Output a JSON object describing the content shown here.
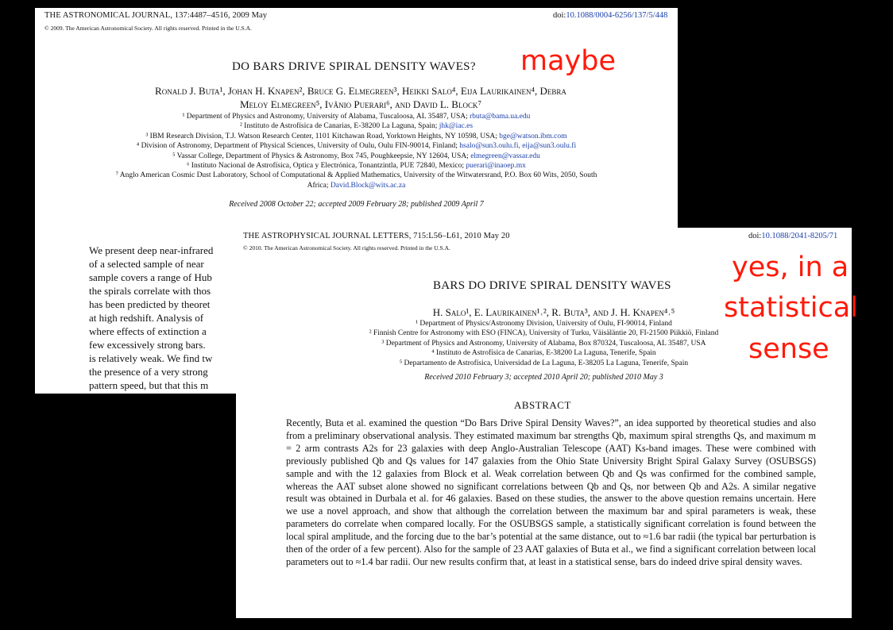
{
  "paper1": {
    "journal": "THE ASTRONOMICAL JOURNAL, 137:4487–4516, 2009 May",
    "doi_prefix": "doi:",
    "doi_link": "10.1088/0004-6256/137/5/448",
    "copyright": "© 2009. The American Astronomical Society. All rights reserved. Printed in the U.S.A.",
    "title": "DO BARS DRIVE SPIRAL DENSITY WAVES?",
    "author_lines": [
      "Ronald J. Buta¹, Johan H. Knapen², Bruce G. Elmegreen³, Heikki Salo⁴, Eija Laurikainen⁴, Debra",
      "Meloy Elmegreen⁵, Ivânio Puerari⁶, and David L. Block⁷"
    ],
    "affiliations": [
      {
        "text": "¹ Department of Physics and Astronomy, University of Alabama, Tuscaloosa, AL 35487, USA; ",
        "email": "rbuta@bama.ua.edu"
      },
      {
        "text": "² Instituto de Astrofísica de Canarias, E-38200 La Laguna, Spain; ",
        "email": "jhk@iac.es"
      },
      {
        "text": "³ IBM Research Division, T.J. Watson Research Center, 1101 Kitchawan Road, Yorktown Heights, NY 10598, USA; ",
        "email": "bge@watson.ibm.com"
      },
      {
        "text": "⁴ Division of Astronomy, Department of Physical Sciences, University of Oulu, Oulu FIN-90014, Finland; ",
        "email": "hsalo@sun3.oulu.fi, eija@sun3.oulu.fi"
      },
      {
        "text": "⁵ Vassar College, Department of Physics & Astronomy, Box 745, Poughkeepsie, NY 12604, USA; ",
        "email": "elmegreen@vassar.edu"
      },
      {
        "text": "⁶ Instituto Nacional de Astrofísica, Optica y Electrónica, Tonantzintla, PUE 72840, Mexico; ",
        "email": "puerari@inaoep.mx"
      },
      {
        "text": "⁷ Anglo American Cosmic Dust Laboratory, School of Computational & Applied Mathematics, University of the Witwatersrand, P.O. Box 60 Wits, 2050, South",
        "email": ""
      },
      {
        "text": "Africa; ",
        "email": "David.Block@wits.ac.za"
      }
    ],
    "received": "Received 2008 October 22; accepted 2009 February 28; published 2009 April 7",
    "abstract_lines": [
      "We present deep near-infrared",
      "of a selected sample of near",
      "sample covers a range of Hub",
      "the spirals correlate with thos",
      "has been predicted by theoret",
      "at high redshift. Analysis of",
      "where effects of extinction a",
      "few excessively strong bars.",
      "is relatively weak. We find tw",
      "the presence of a very strong",
      "pattern speed, but that this m"
    ]
  },
  "paper2": {
    "journal": "THE ASTROPHYSICAL JOURNAL LETTERS, 715:L56–L61, 2010 May 20",
    "doi_prefix": "doi:",
    "doi_link": "10.1088/2041-8205/71",
    "copyright": "© 2010. The American Astronomical Society. All rights reserved. Printed in the U.S.A.",
    "title": "BARS DO DRIVE SPIRAL DENSITY WAVES",
    "authors": "H. Salo¹, E. Laurikainen¹˒², R. Buta³, and J. H. Knapen⁴˒⁵",
    "affiliations": [
      "¹ Department of Physics/Astronomy Division, University of Oulu, FI-90014, Finland",
      "² Finnish Centre for Astronomy with ESO (FINCA), University of Turku, Väisäläntie 20, FI-21500 Piikkiö, Finland",
      "³ Department of Physics and Astronomy, University of Alabama, Box 870324, Tuscaloosa, AL 35487, USA",
      "⁴ Instituto de Astrofísica de Canarias, E-38200 La Laguna, Tenerife, Spain",
      "⁵ Departamento de Astrofísica, Universidad de La Laguna, E-38205 La Laguna, Tenerife, Spain"
    ],
    "received": "Received 2010 February 3; accepted 2010 April 20; published 2010 May 3",
    "abstract_heading": "ABSTRACT",
    "abstract": "Recently, Buta et al. examined the question “Do Bars Drive Spiral Density Waves?”, an idea supported by theoretical studies and also from a preliminary observational analysis. They estimated maximum bar strengths Qb, maximum spiral strengths Qs, and maximum m = 2 arm contrasts A2s for 23 galaxies with deep Anglo-Australian Telescope (AAT) Ks-band images. These were combined with previously published Qb and Qs values for 147 galaxies from the Ohio State University Bright Spiral Galaxy Survey (OSUBSGS) sample and with the 12 galaxies from Block et al. Weak correlation between Qb and Qs was confirmed for the combined sample, whereas the AAT subset alone showed no significant correlations between Qb and Qs, nor between Qb and A2s. A similar negative result was obtained in Durbala et al. for 46 galaxies. Based on these studies, the answer to the above question remains uncertain. Here we use a novel approach, and show that although the correlation between the maximum bar and spiral parameters is weak, these parameters do correlate when compared locally. For the OSUBSGS sample, a statistically significant correlation is found between the local spiral amplitude, and the forcing due to the bar’s potential at the same distance, out to ≈1.6 bar radii (the typical bar perturbation is then of the order of a few percent). Also for the sample of 23 AAT galaxies of Buta et al., we find a significant correlation between local parameters out to ≈1.4 bar radii. Our new results confirm that, at least in a statistical sense, bars do indeed drive spiral density waves."
  },
  "annotations": {
    "maybe": "maybe",
    "yes_lines": [
      "yes, in a",
      "statistical",
      "sense"
    ],
    "color": "#ff1a0a"
  }
}
